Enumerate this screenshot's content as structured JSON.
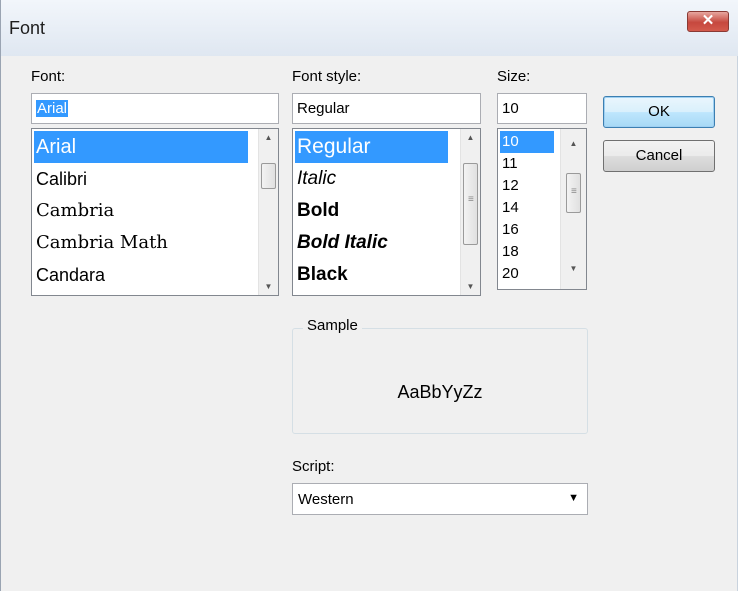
{
  "window": {
    "title": "Font",
    "close_glyph": "✕"
  },
  "font": {
    "label": "Font:",
    "value": "Arial",
    "items": [
      "Arial",
      "Calibri",
      "Cambria",
      "Cambria Math",
      "Candara"
    ],
    "selected": "Arial"
  },
  "style": {
    "label": "Font style:",
    "value": "Regular",
    "items": [
      "Regular",
      "Italic",
      "Bold",
      "Bold Italic",
      "Black"
    ],
    "selected": "Regular"
  },
  "size": {
    "label": "Size:",
    "value": "10",
    "items": [
      "10",
      "11",
      "12",
      "14",
      "16",
      "18",
      "20"
    ],
    "selected": "10"
  },
  "buttons": {
    "ok": "OK",
    "cancel": "Cancel"
  },
  "sample": {
    "label": "Sample",
    "text": "AaBbYyZz"
  },
  "script": {
    "label": "Script:",
    "value": "Western"
  },
  "icons": {
    "scroll_up": "up-arrow-icon",
    "scroll_down": "down-arrow-icon",
    "dropdown": "chevron-down-icon",
    "close": "close-icon"
  },
  "colors": {
    "selection": "#3399ff",
    "close_button": "#c6483e"
  }
}
